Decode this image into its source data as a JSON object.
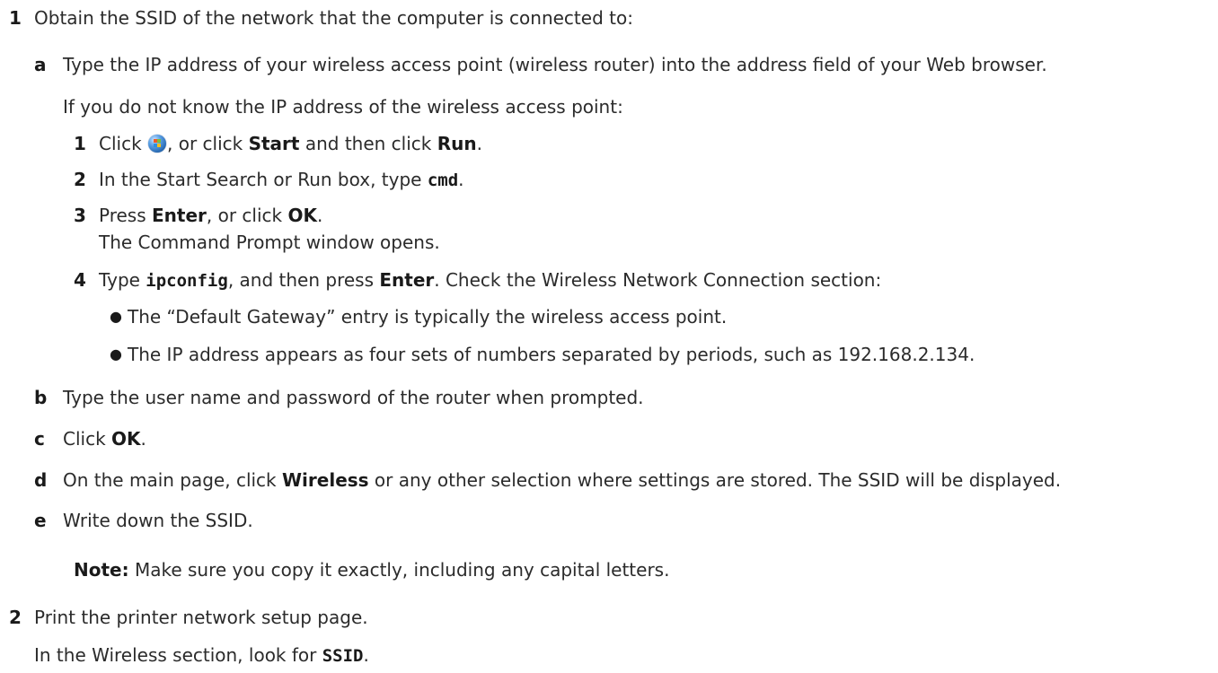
{
  "step1": {
    "num": "1",
    "text": "Obtain the SSID of the network that the computer is connected to:",
    "a": {
      "letter": "a",
      "text": "Type the IP address of your wireless access point (wireless router) into the address field of your Web browser.",
      "intro": "If you do not know the IP address of the wireless access point:",
      "sub1": {
        "num": "1",
        "pre": "Click ",
        "mid1": ", or click ",
        "start": "Start",
        "mid2": " and then click ",
        "run": "Run",
        "post": "."
      },
      "sub2": {
        "num": "2",
        "pre": "In the Start Search or Run box, type ",
        "cmd": "cmd",
        "post": "."
      },
      "sub3": {
        "num": "3",
        "pre": "Press ",
        "enter": "Enter",
        "mid": ", or click ",
        "ok": "OK",
        "post": ".",
        "line2": "The Command Prompt window opens."
      },
      "sub4": {
        "num": "4",
        "pre": "Type ",
        "ipconfig": "ipconfig",
        "mid": ", and then press ",
        "enter": "Enter",
        "post": ". Check the Wireless Network Connection section:",
        "bullet1": "The “Default Gateway” entry is typically the wireless access point.",
        "bullet2": "The IP address appears as four sets of numbers separated by periods, such as 192.168.2.134."
      }
    },
    "b": {
      "letter": "b",
      "text": "Type the user name and password of the router when prompted."
    },
    "c": {
      "letter": "c",
      "pre": "Click ",
      "ok": "OK",
      "post": "."
    },
    "d": {
      "letter": "d",
      "pre": "On the main page, click ",
      "wireless": "Wireless",
      "post": " or any other selection where settings are stored. The SSID will be displayed."
    },
    "e": {
      "letter": "e",
      "text": "Write down the SSID."
    },
    "note": {
      "label": "Note:",
      "text": " Make sure you copy it exactly, including any capital letters."
    }
  },
  "step2": {
    "num": "2",
    "text": "Print the printer network setup page.",
    "line2_pre": "In the Wireless section, look for ",
    "ssid": "SSID",
    "line2_post": "."
  }
}
